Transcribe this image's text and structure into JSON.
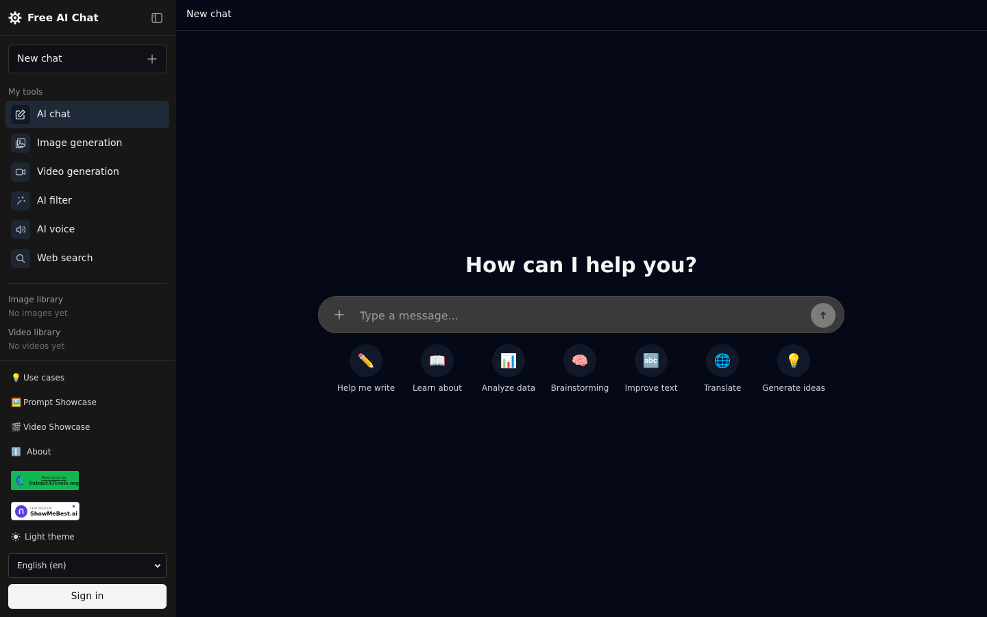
{
  "app": {
    "name": "Free AI Chat"
  },
  "sidebar": {
    "new_chat_label": "New chat",
    "tools_section_label": "My tools",
    "tools": [
      {
        "label": "AI chat",
        "icon": "edit-icon",
        "active": true
      },
      {
        "label": "Image generation",
        "icon": "image-icon",
        "active": false
      },
      {
        "label": "Video generation",
        "icon": "video-icon",
        "active": false
      },
      {
        "label": "AI filter",
        "icon": "sparkles-icon",
        "active": false
      },
      {
        "label": "AI voice",
        "icon": "speaker-icon",
        "active": false
      },
      {
        "label": "Web search",
        "icon": "search-icon",
        "active": false
      }
    ],
    "image_library": {
      "title": "Image library",
      "empty": "No images yet"
    },
    "video_library": {
      "title": "Video library",
      "empty": "No videos yet"
    },
    "links": [
      {
        "emoji": "💡",
        "label": "Use cases"
      },
      {
        "emoji": "🖼️",
        "label": "Prompt Showcase"
      },
      {
        "emoji": "🎬",
        "label": "Video Showcase"
      },
      {
        "emoji": "ℹ️",
        "label": "About"
      }
    ],
    "badges": [
      {
        "small": "Featured on",
        "big": "SubmitAITools.org"
      },
      {
        "small": "FEATURED ON",
        "big": "ShowMeBest.ai"
      }
    ],
    "theme_label": "Light theme",
    "language": {
      "selected": "English (en)"
    },
    "sign_in_label": "Sign in"
  },
  "main": {
    "header_title": "New chat",
    "hero_title": "How can I help you?",
    "composer": {
      "placeholder": "Type a message..."
    },
    "suggestions": [
      {
        "emoji": "✏️",
        "label": "Help me write"
      },
      {
        "emoji": "📖",
        "label": "Learn about"
      },
      {
        "emoji": "📊",
        "label": "Analyze data"
      },
      {
        "emoji": "🧠",
        "label": "Brainstorming"
      },
      {
        "emoji": "🔤",
        "label": "Improve text"
      },
      {
        "emoji": "🌐",
        "label": "Translate"
      },
      {
        "emoji": "💡",
        "label": "Generate ideas"
      }
    ]
  },
  "colors": {
    "sidebar_bg": "#171717",
    "main_bg": "#050816",
    "active_item_bg": "#1f2937",
    "composer_bg": "#3a3a3a",
    "badge_green": "#10b950"
  }
}
